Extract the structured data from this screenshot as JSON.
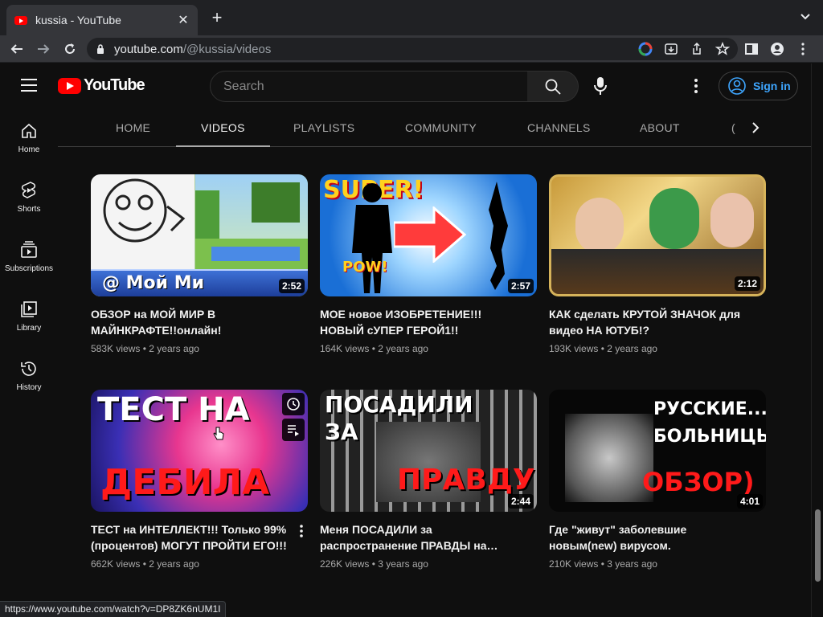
{
  "browser": {
    "tab_title": "kussia - YouTube",
    "url_host": "youtube.com",
    "url_path": "/@kussia/videos",
    "status_url": "https://www.youtube.com/watch?v=DP8ZK6nUM1I"
  },
  "masthead": {
    "logo_text": "YouTube",
    "search_placeholder": "Search",
    "signin_label": "Sign in"
  },
  "guide": {
    "items": [
      {
        "label": "Home",
        "icon": "home-icon"
      },
      {
        "label": "Shorts",
        "icon": "shorts-icon"
      },
      {
        "label": "Subscriptions",
        "icon": "subscriptions-icon"
      },
      {
        "label": "Library",
        "icon": "library-icon"
      },
      {
        "label": "History",
        "icon": "history-icon"
      }
    ]
  },
  "channel_tabs": {
    "items": [
      "HOME",
      "VIDEOS",
      "PLAYLISTS",
      "COMMUNITY",
      "CHANNELS",
      "ABOUT"
    ],
    "active": "VIDEOS"
  },
  "videos": [
    {
      "title": "ОБЗОР на МОЙ МИР В МАЙНКРАФТЕ!!онлайн!",
      "views": "583K views",
      "age": "2 years ago",
      "duration": "2:52",
      "thumb_text": "@ Мой Ми"
    },
    {
      "title": "МОЕ новое ИЗОБРЕТЕНИЕ!!! НОВЫЙ сУПЕР ГЕРОЙ1!!",
      "views": "164K views",
      "age": "2 years ago",
      "duration": "2:57",
      "thumb_text": "SUPER!"
    },
    {
      "title": "КАК сделать КРУТОЙ ЗНАЧОК для видео НА ЮТУБ!?",
      "views": "193K views",
      "age": "2 years ago",
      "duration": "2:12",
      "thumb_text": ""
    },
    {
      "title": "ТЕСТ на ИНТЕЛЛЕКТ!!! Только 99% (процентов) МОГУТ ПРОЙТИ ЕГО!!!",
      "views": "662K views",
      "age": "2 years ago",
      "duration": "",
      "thumb_text_top": "ТЕСТ НА",
      "thumb_text_bottom": "ДЕБИЛА"
    },
    {
      "title": "Меня ПОСАДИЛИ за распространение ПРАВДЫ на…",
      "views": "226K views",
      "age": "3 years ago",
      "duration": "2:44",
      "thumb_text_top": "ПОСАДИЛИ ЗА",
      "thumb_text_bottom": "ПРАВДУ"
    },
    {
      "title": "Где \"живут\" заболевшие новым(new) вирусом.",
      "views": "210K views",
      "age": "3 years ago",
      "duration": "4:01",
      "thumb_text_top": "РУССКИЕ... БОЛЬНИЦЫ",
      "thumb_text_bottom": "ОБЗОР)"
    }
  ],
  "meta_separator": "•",
  "colors": {
    "accent_red": "#ff0000",
    "link_blue": "#3ea6ff",
    "bg": "#0f0f0f"
  }
}
